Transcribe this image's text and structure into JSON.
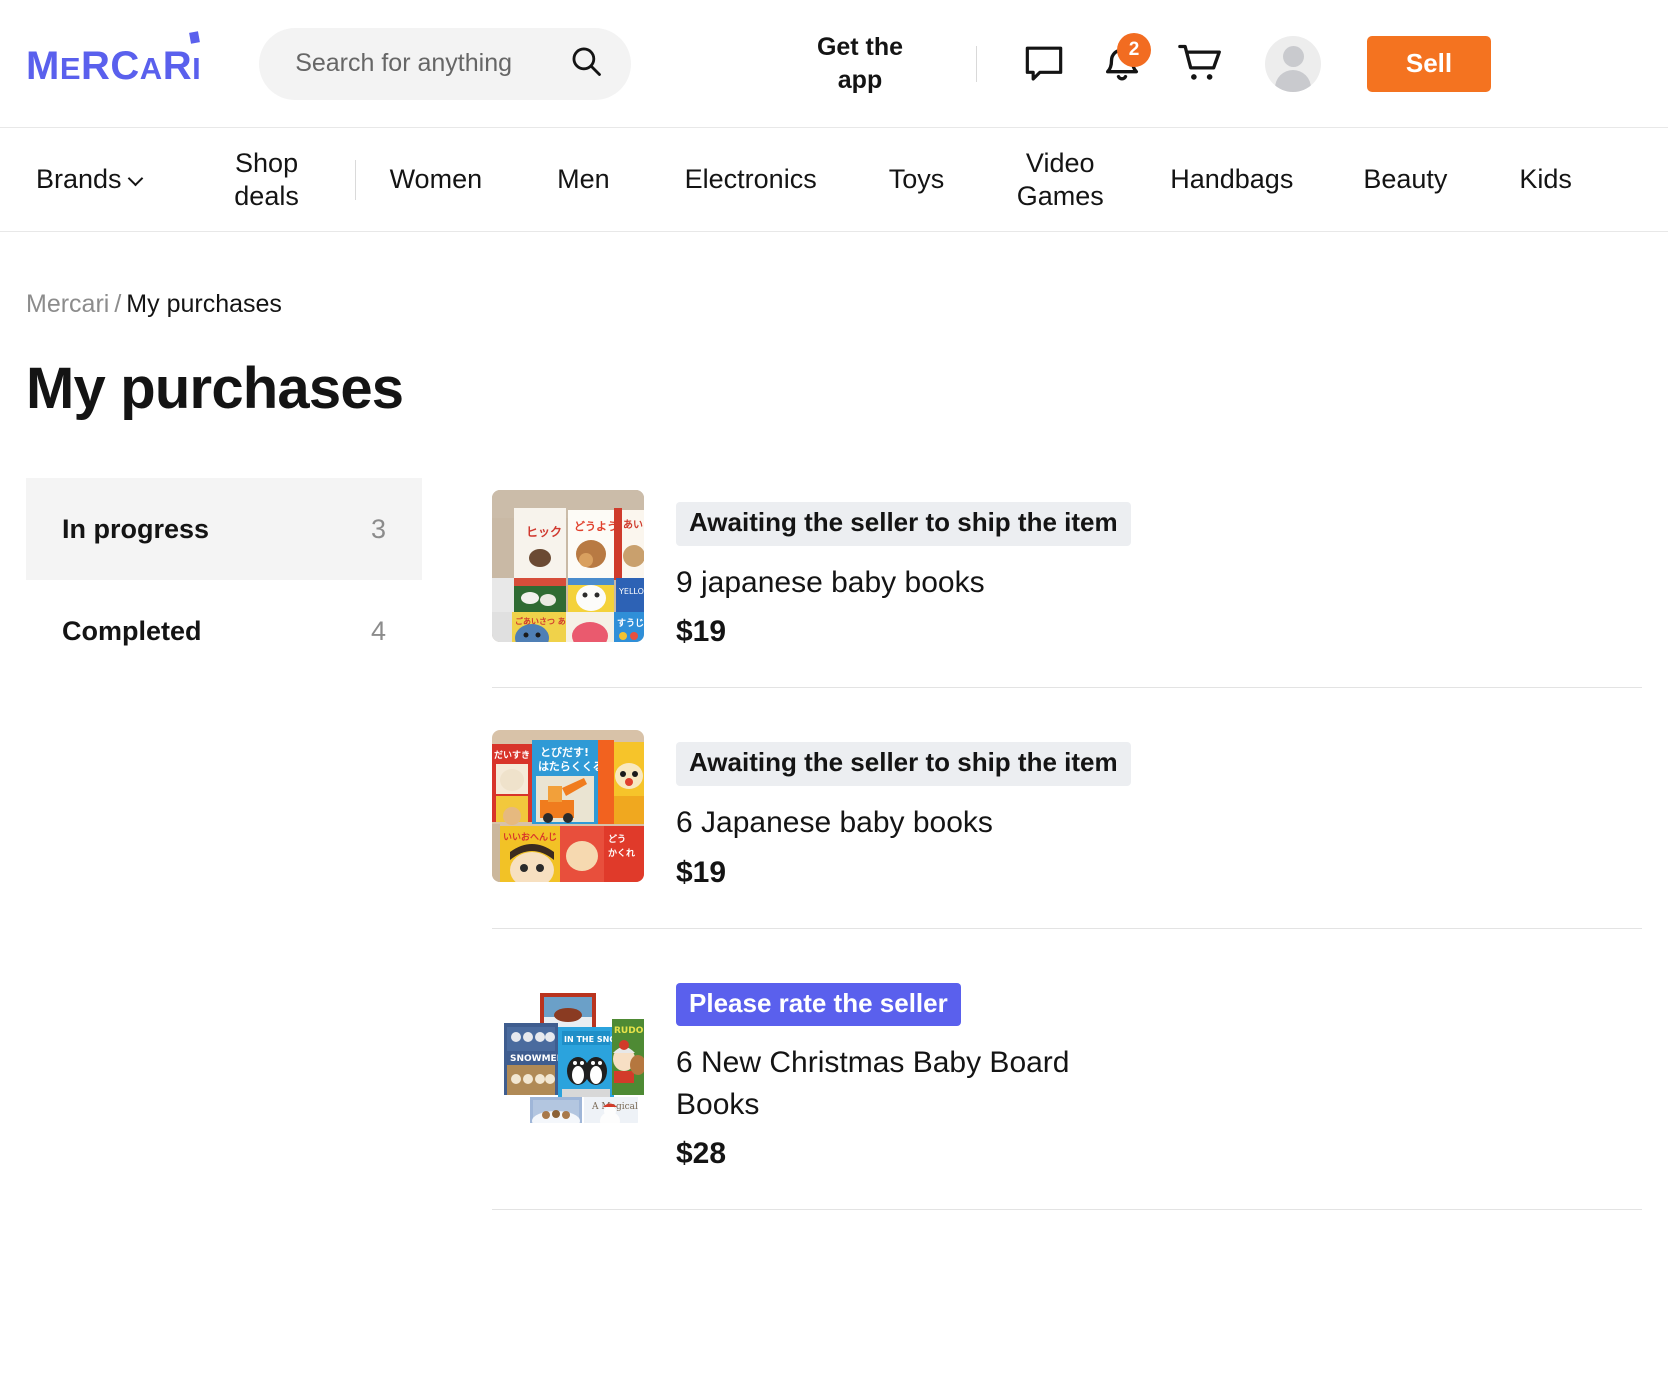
{
  "header": {
    "logo_text": "MERCARI",
    "search": {
      "placeholder": "Search for anything",
      "value": ""
    },
    "get_app_label": "Get the app",
    "messages_icon": "message-icon",
    "notifications_icon": "bell-icon",
    "notifications_count": "2",
    "cart_icon": "cart-icon",
    "avatar_icon": "avatar-icon",
    "sell_label": "Sell",
    "accent_orange": "#F47320",
    "brand_blue": "#5A60ED"
  },
  "nav": {
    "brands_label": "Brands",
    "shop_deals_label": "Shop deals",
    "items": [
      {
        "label": "Women"
      },
      {
        "label": "Men"
      },
      {
        "label": "Electronics"
      },
      {
        "label": "Toys"
      },
      {
        "label": "Video Games"
      },
      {
        "label": "Handbags"
      },
      {
        "label": "Beauty"
      },
      {
        "label": "Kids"
      }
    ]
  },
  "breadcrumb": {
    "root": "Mercari",
    "separator": "/",
    "current": "My purchases"
  },
  "page_title": "My purchases",
  "sidebar": {
    "tabs": [
      {
        "label": "In progress",
        "count": "3",
        "active": true
      },
      {
        "label": "Completed",
        "count": "4",
        "active": false
      }
    ]
  },
  "purchases": [
    {
      "status": "Awaiting the seller to ship the item",
      "status_style": "gray",
      "title": "9 japanese baby books",
      "price": "$19",
      "thumb_name": "japanese-baby-books-photo"
    },
    {
      "status": "Awaiting the seller to ship the item",
      "status_style": "gray",
      "title": "6 Japanese baby books",
      "price": "$19",
      "thumb_name": "japanese-baby-books-photo"
    },
    {
      "status": "Please rate the seller",
      "status_style": "blue",
      "title": "6 New Christmas Baby Board Books",
      "price": "$28",
      "thumb_name": "christmas-board-books-photo"
    }
  ]
}
